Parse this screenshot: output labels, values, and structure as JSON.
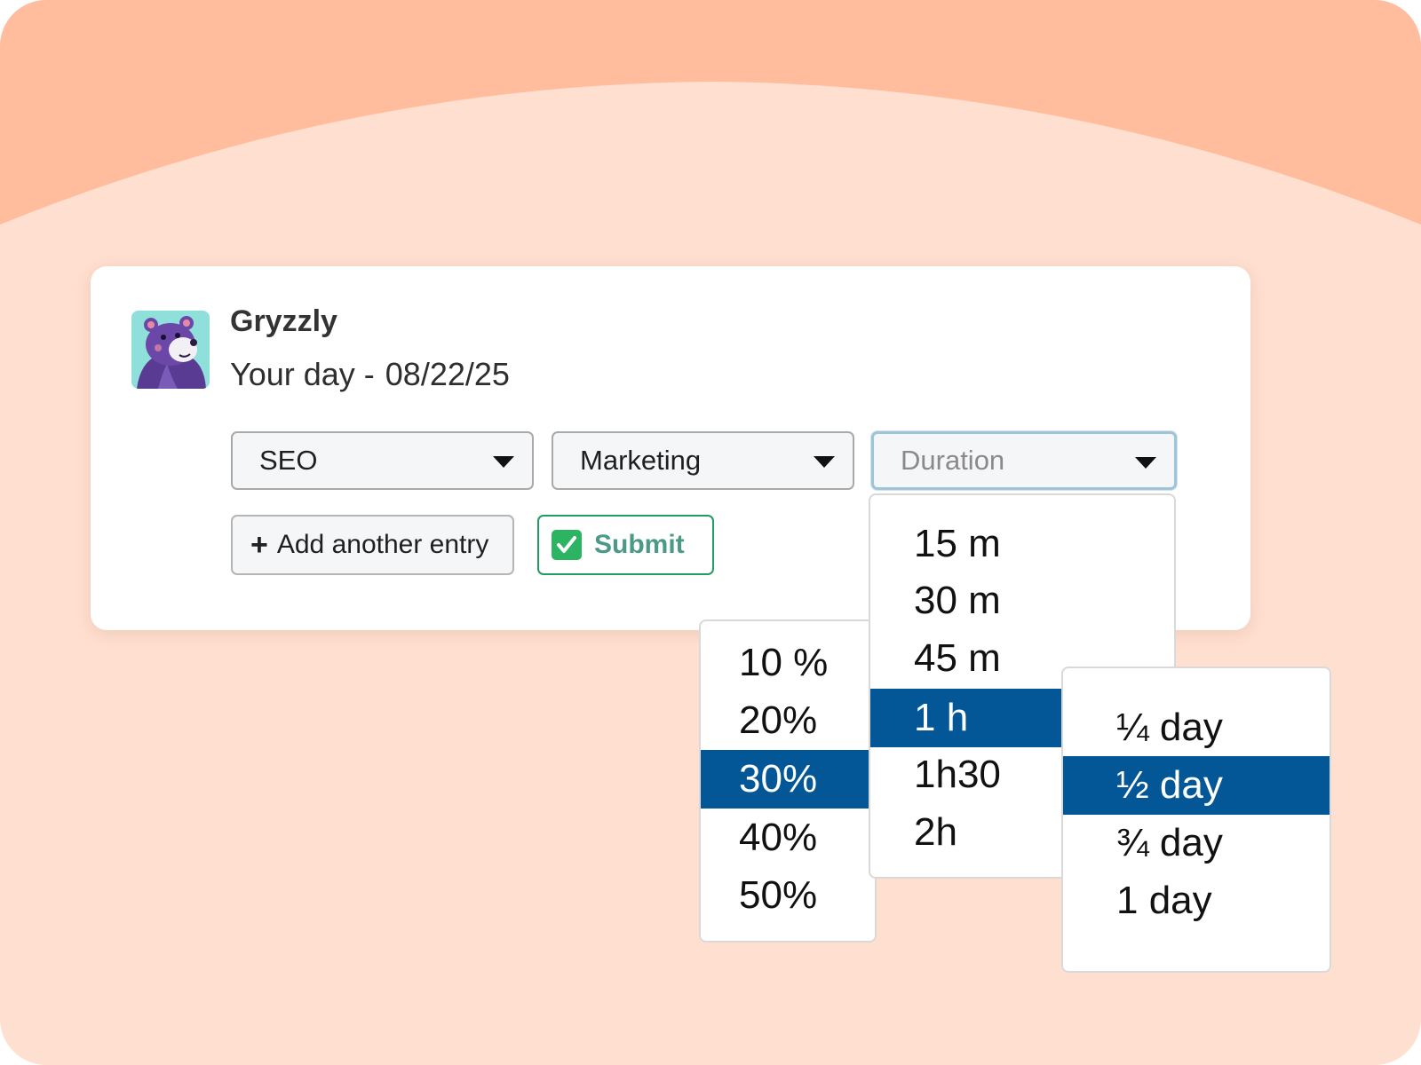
{
  "header": {
    "app_name": "Gryzzly",
    "subtitle_prefix": "Your day -",
    "date": "08/22/25"
  },
  "selects": {
    "project": {
      "value": "SEO"
    },
    "category": {
      "value": "Marketing"
    },
    "duration": {
      "placeholder": "Duration"
    }
  },
  "buttons": {
    "add_entry": "Add another entry",
    "submit": "Submit"
  },
  "menus": {
    "percent": {
      "options": [
        "10 %",
        "20%",
        "30%",
        "40%",
        "50%"
      ],
      "selected": "30%"
    },
    "duration": {
      "options": [
        "15 m",
        "30 m",
        "45 m",
        "1 h",
        "1h30",
        "2h"
      ],
      "selected": "1 h"
    },
    "day": {
      "options": [
        "¼ day",
        "½ day",
        "¾ day",
        "1 day"
      ],
      "selected": "½ day"
    }
  },
  "colors": {
    "background_top": "#ffbd9e",
    "background": "#ffdfd0",
    "selected_option": "#045796",
    "submit_border": "#1f9d63",
    "avatar_bg": "#8fe0db"
  },
  "icons": {
    "avatar": "bear-mascot-icon",
    "caret": "caret-down-icon",
    "add": "plus-icon",
    "submit": "check-box-icon"
  }
}
